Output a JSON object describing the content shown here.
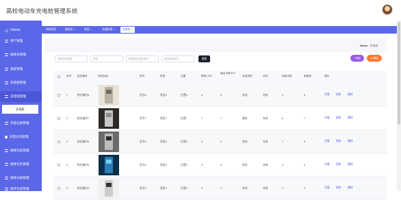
{
  "app": {
    "title": "高校电动车充电桩管理系统"
  },
  "sidebar": {
    "home": "Home",
    "items": [
      {
        "label": "用户管理",
        "icon": "list-icon"
      },
      {
        "label": "维修员管理",
        "icon": "list-icon"
      },
      {
        "label": "类型管理",
        "icon": "list-icon"
      },
      {
        "label": "充电桩管理",
        "icon": "list-icon"
      },
      {
        "label": "充电桩管理",
        "icon": "list-icon"
      },
      {
        "label": "充电记录管理",
        "icon": "list-icon"
      },
      {
        "label": "充电合议管理",
        "icon": "pin-icon"
      },
      {
        "label": "维修信息管理",
        "icon": "list-icon"
      },
      {
        "label": "维修任务管理",
        "icon": "list-icon"
      },
      {
        "label": "维修记录管理",
        "icon": "list-icon"
      },
      {
        "label": "损坏信息管理",
        "icon": "list-icon"
      }
    ],
    "active_sub": "充电桩"
  },
  "tabs": [
    "系统首页",
    "维修员 ×",
    "类型 ×",
    "充值新规 ×",
    "充电桩 ×"
  ],
  "breadcrumb": {
    "home": "Home",
    "current": "充电桩"
  },
  "filters": {
    "f1": "请选择充电桩",
    "f2": "型号",
    "f3": "请选择充电桩类型",
    "f4": "请选择维修员"
  },
  "buttons": {
    "search": "搜索",
    "add": "+ 增加",
    "delete": "删除"
  },
  "table": {
    "headers": [
      "序号",
      "桩柱编号",
      "电桩封面",
      "型号",
      "类型",
      "位置",
      "费用/小时",
      "输出功率/KW",
      "电池类型",
      "状态",
      "使用次数",
      "报废数",
      "操作"
    ],
    "actions": [
      "详情",
      "更新",
      "删除"
    ],
    "rows": [
      {
        "no": "1",
        "code": "桩柱编号8",
        "model": "型号8",
        "type": "类型8",
        "pos": "位置8",
        "fee": "8",
        "power": "8",
        "battery": "快充",
        "status": "充电",
        "uses": "9",
        "scrap": "8"
      },
      {
        "no": "2",
        "code": "桩柱编号7",
        "model": "型号7",
        "type": "类型7",
        "pos": "位置7",
        "fee": "7",
        "power": "7",
        "battery": "慢充",
        "status": "充电",
        "uses": "8",
        "scrap": "7"
      },
      {
        "no": "3",
        "code": "桩柱编号6",
        "model": "型号6",
        "type": "类型6",
        "pos": "位置6",
        "fee": "6",
        "power": "6",
        "battery": "快充",
        "status": "充电",
        "uses": "7",
        "scrap": "6"
      },
      {
        "no": "4",
        "code": "桩柱编号5",
        "model": "型号5",
        "type": "类型5",
        "pos": "位置5",
        "fee": "5",
        "power": "5",
        "battery": "快充",
        "status": "充电",
        "uses": "5",
        "scrap": "5"
      },
      {
        "no": "5",
        "code": "桩柱编号4",
        "model": "型号4",
        "type": "类型4",
        "pos": "位置4",
        "fee": "4",
        "power": "4",
        "battery": "快充",
        "status": "充电",
        "uses": "4",
        "scrap": "4"
      }
    ]
  },
  "colors": {
    "primary": "#5a67e8",
    "add": "#9b59e8",
    "delete": "#ff7a33",
    "search": "#1c1e2a"
  }
}
